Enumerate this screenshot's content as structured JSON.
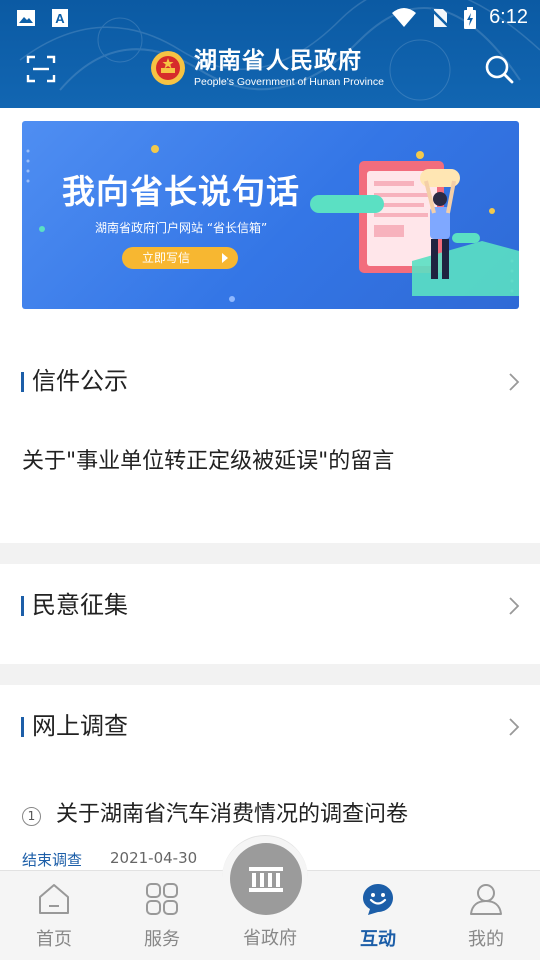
{
  "status_bar": {
    "time": "6:12",
    "icons": [
      "image-icon",
      "a-icon",
      "wifi-icon",
      "no-sim-icon",
      "battery-icon"
    ]
  },
  "header": {
    "title": "湖南省人民政府",
    "subtitle": "People's Government of Hunan Province",
    "left_icon": "scan-icon",
    "right_icon": "search-icon"
  },
  "banner": {
    "title": "我向省长说句话",
    "subtitle": "湖南省政府门户网站 “省长信箱”",
    "button_label": "立即写信"
  },
  "sections": {
    "letters": {
      "title": "信件公示",
      "items": [
        "关于\"事业单位转正定级被延误\"的留言"
      ]
    },
    "opinion": {
      "title": "民意征集"
    },
    "survey": {
      "title": "网上调查",
      "items": [
        {
          "index": "1",
          "title": "关于湖南省汽车消费情况的调查问卷",
          "status": "结束调查",
          "date": "2021-04-30"
        }
      ]
    }
  },
  "bottom_nav": {
    "items": [
      {
        "label": "首页",
        "icon": "home-icon"
      },
      {
        "label": "服务",
        "icon": "grid-icon"
      },
      {
        "label": "省政府",
        "icon": "building-icon"
      },
      {
        "label": "互动",
        "icon": "chat-smile-icon",
        "active": true
      },
      {
        "label": "我的",
        "icon": "user-icon"
      }
    ]
  },
  "colors": {
    "header_blue": "#0d5fa8",
    "accent_blue": "#1c5ea8",
    "banner_blue": "#3a7ee8",
    "button_orange": "#f7b731"
  }
}
